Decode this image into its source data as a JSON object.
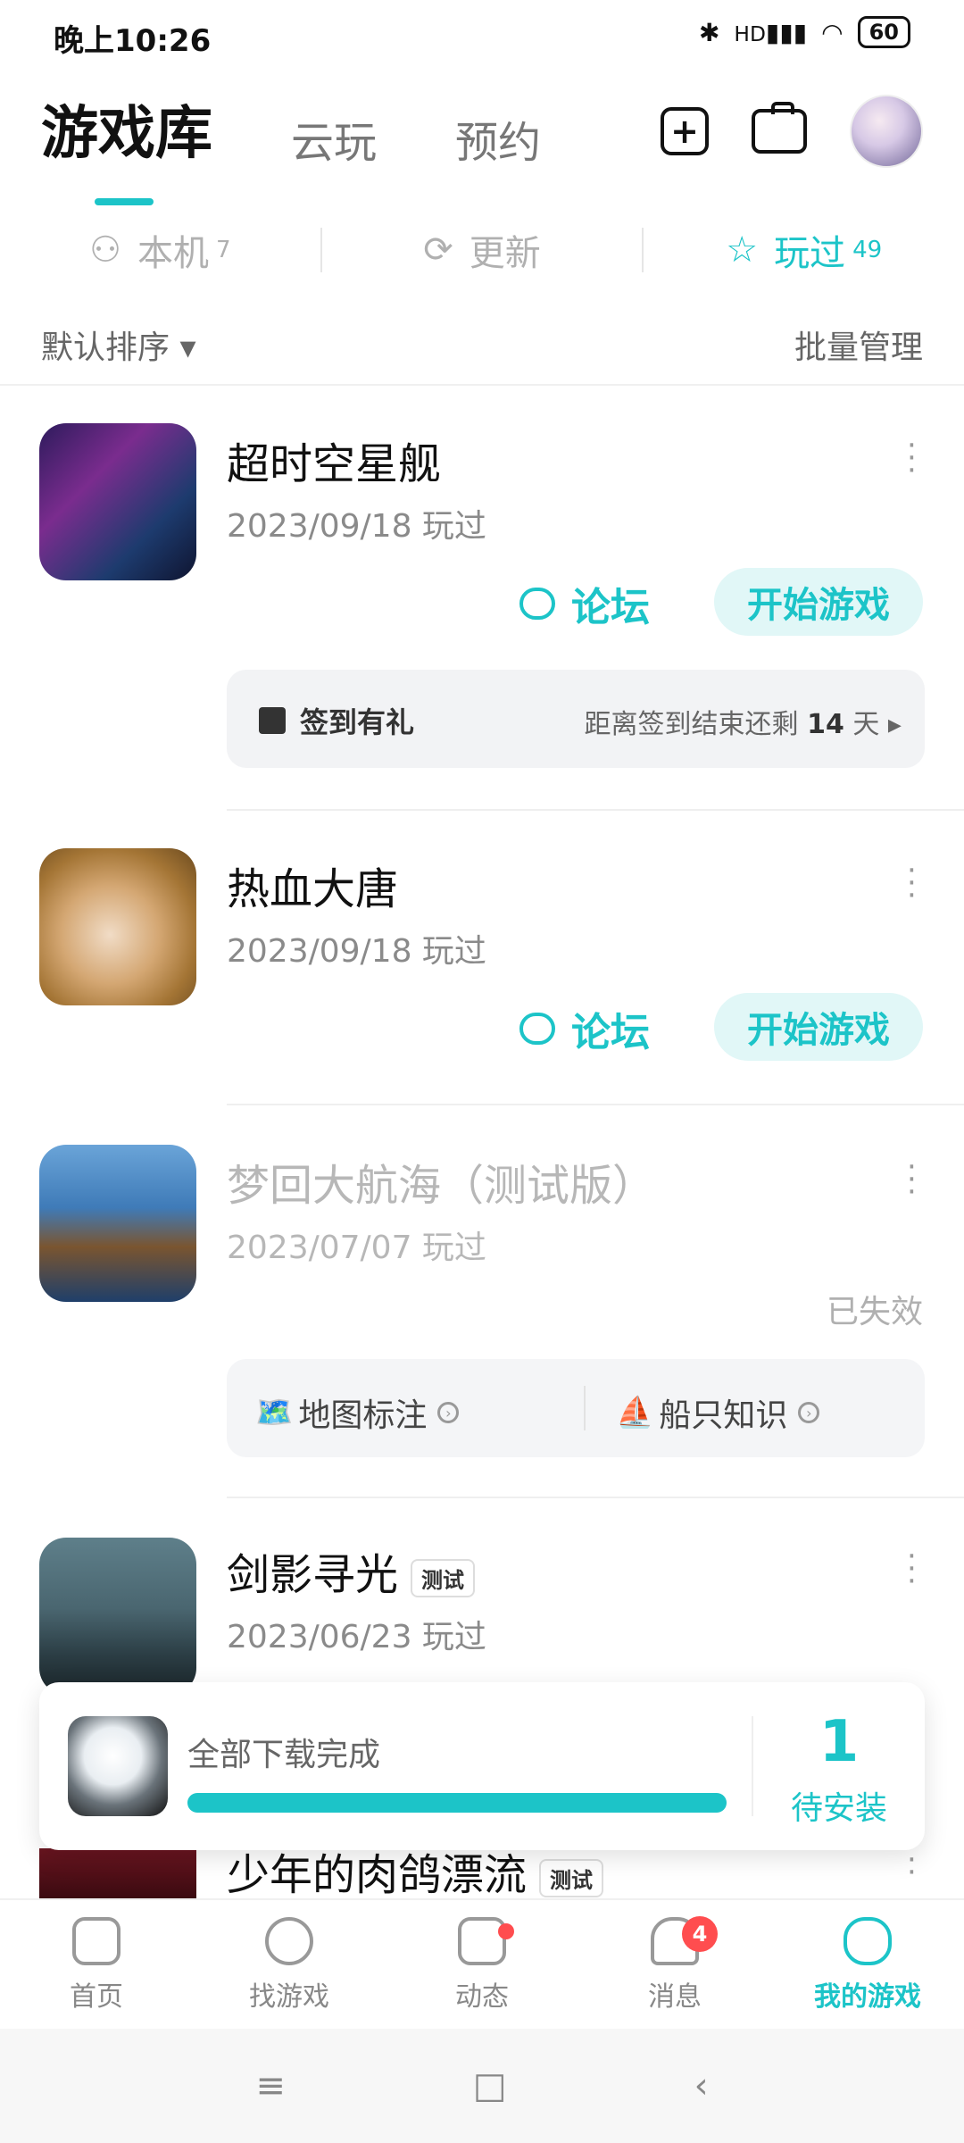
{
  "status_bar": {
    "time": "晚上10:26",
    "network": "HD",
    "battery": "60"
  },
  "header": {
    "tabs": [
      {
        "label": "游戏库",
        "active": true
      },
      {
        "label": "云玩",
        "active": false
      },
      {
        "label": "预约",
        "active": false
      }
    ],
    "add_icon": "add-square-icon",
    "toolbox_icon": "briefcase-icon"
  },
  "filters": [
    {
      "label": "本机",
      "count": "7",
      "icon": "person-icon",
      "active": false
    },
    {
      "label": "更新",
      "count": "",
      "icon": "refresh-icon",
      "active": false
    },
    {
      "label": "玩过",
      "count": "49",
      "icon": "star-icon",
      "active": true
    }
  ],
  "sort": {
    "label": "默认排序",
    "manage": "批量管理"
  },
  "games": [
    {
      "title": "超时空星舰",
      "date": "2023/09/18 玩过",
      "forum": "论坛",
      "start": "开始游戏",
      "sign": {
        "label": "签到有礼",
        "prefix": "距离签到结束还剩",
        "days": "14",
        "suffix": "天"
      }
    },
    {
      "title": "热血大唐",
      "date": "2023/09/18 玩过",
      "forum": "论坛",
      "start": "开始游戏"
    },
    {
      "title": "梦回大航海（测试版）",
      "date": "2023/07/07 玩过",
      "status": "已失效",
      "links": [
        {
          "label": "地图标注",
          "emoji": "🗺️"
        },
        {
          "label": "船只知识",
          "emoji": "⛵"
        }
      ]
    },
    {
      "title": "剑影寻光",
      "tag": "测试",
      "date": "2023/06/23 玩过"
    },
    {
      "title": "少年的肉鸽漂流",
      "tag": "测试"
    }
  ],
  "download_toast": {
    "text": "全部下载完成",
    "progress": 1.0,
    "count": "1",
    "pending": "待安装"
  },
  "bottom_nav": [
    {
      "label": "首页",
      "icon": "home-icon",
      "active": false
    },
    {
      "label": "找游戏",
      "icon": "planet-icon",
      "active": false
    },
    {
      "label": "动态",
      "icon": "chat-icon",
      "active": false,
      "dot": true
    },
    {
      "label": "消息",
      "icon": "bell-icon",
      "active": false,
      "badge": "4"
    },
    {
      "label": "我的游戏",
      "icon": "gamepad-icon",
      "active": true
    }
  ],
  "colors": {
    "accent": "#1cc4c8",
    "badge": "#ff4d4f"
  }
}
